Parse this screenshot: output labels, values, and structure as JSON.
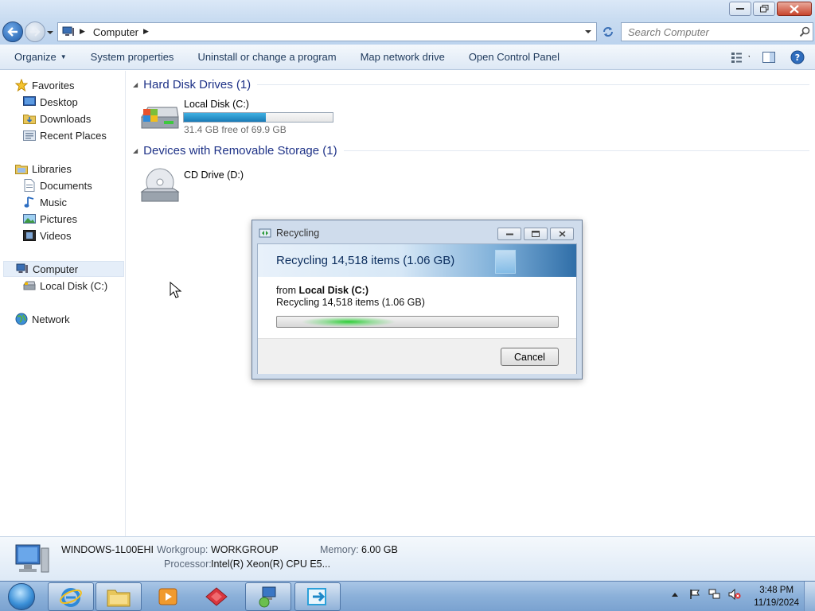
{
  "window": {
    "buttons": {
      "minimize": "minimize",
      "restore": "restore",
      "close": "close"
    }
  },
  "address": {
    "location": "Computer",
    "search_placeholder": "Search Computer"
  },
  "commands": {
    "organize": "Organize",
    "system_properties": "System properties",
    "uninstall": "Uninstall or change a program",
    "map_drive": "Map network drive",
    "control_panel": "Open Control Panel"
  },
  "nav": {
    "favorites": "Favorites",
    "desktop": "Desktop",
    "downloads": "Downloads",
    "recent": "Recent Places",
    "libraries": "Libraries",
    "documents": "Documents",
    "music": "Music",
    "pictures": "Pictures",
    "videos": "Videos",
    "computer": "Computer",
    "local_disk": "Local Disk (C:)",
    "network": "Network"
  },
  "content": {
    "hdd_group": "Hard Disk Drives (1)",
    "removable_group": "Devices with Removable Storage (1)",
    "drive_c": {
      "name": "Local Disk (C:)",
      "free": "31.4 GB free of 69.9 GB",
      "used_fraction": 0.551
    },
    "drive_d": {
      "name": "CD Drive (D:)"
    }
  },
  "dialog": {
    "title": "Recycling",
    "header": "Recycling 14,518 items (1.06 GB)",
    "from_prefix": "from",
    "from_source": "Local Disk (C:)",
    "status": "Recycling 14,518 items (1.06 GB)",
    "cancel": "Cancel"
  },
  "details": {
    "computer_name": "WINDOWS-1L00EHI",
    "workgroup_label": "Workgroup:",
    "workgroup": "WORKGROUP",
    "memory_label": "Memory:",
    "memory": "6.00 GB",
    "processor_label": "Processor:",
    "processor": "Intel(R) Xeon(R) CPU E5..."
  },
  "taskbar": {
    "time": "3:48 PM",
    "date": "11/19/2024"
  },
  "colors": {
    "accent": "#1e3287",
    "capacity_fill": "#2a94cd",
    "progress_glow": "#2ccd35"
  }
}
